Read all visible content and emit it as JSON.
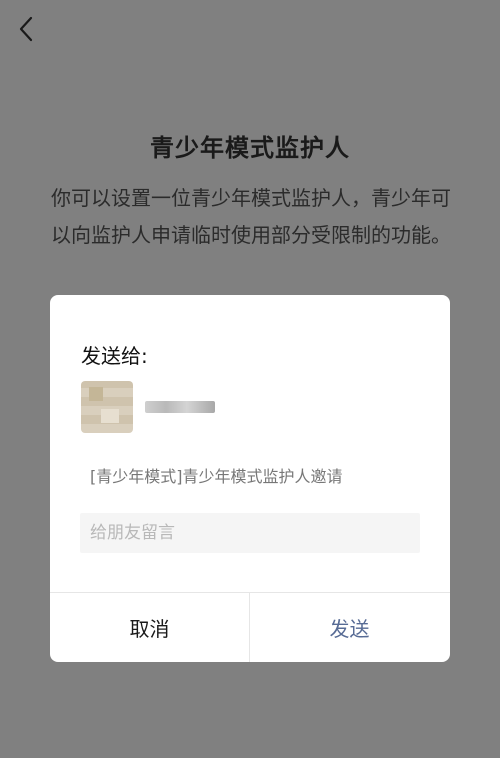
{
  "page": {
    "title": "青少年模式监护人",
    "description": "你可以设置一位青少年模式监护人，青少年可以向监护人申请临时使用部分受限制的功能。"
  },
  "icons": {
    "back": "chevron-left-icon"
  },
  "dialog": {
    "send_to_label": "发送给:",
    "share_title": "[青少年模式]青少年模式监护人邀请",
    "message_placeholder": "给朋友留言",
    "cancel_label": "取消",
    "send_label": "发送"
  },
  "colors": {
    "overlay_background": "#808080",
    "send_button": "#576b95"
  }
}
